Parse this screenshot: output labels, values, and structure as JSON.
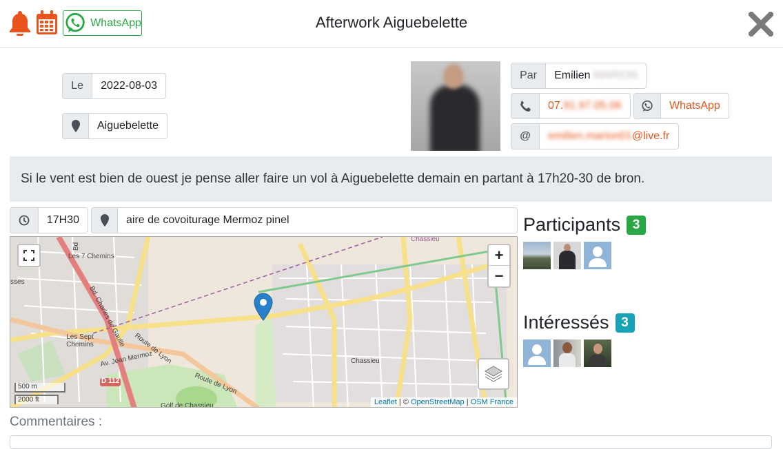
{
  "header": {
    "title": "Afterwork Aiguebelette",
    "whatsapp_label": "WhatsApp",
    "accent": "#e8541b",
    "whatsapp_color": "#28a745"
  },
  "event": {
    "date_label": "Le",
    "date": "2022-08-03",
    "location": "Aiguebelette",
    "description": "Si le vent est bien de ouest je pense aller faire un vol à Aiguebelette demain en partant à 17h20-30 de bron.",
    "time": "17H30",
    "meeting_point": "aire de covoiturage Mermoz pinel"
  },
  "organizer": {
    "by_label": "Par",
    "first_name": "Emilien",
    "last_name_blurred": "MARION",
    "phone_prefix": "07.",
    "phone_blurred": "91.97.05.06",
    "whatsapp_label": "WhatsApp",
    "email_label": "@",
    "email_blurred": "emilien.marion01",
    "email_domain": "@live.fr"
  },
  "map": {
    "labels": {
      "chassieu": "Chassieu",
      "chassieu_top": "Chassieu",
      "les7chemins_top": "Les 7 Chemins",
      "les7chemins": "Les Sept Chemins",
      "bd_charles": "Bd. Charles de Gaulle",
      "av_mermoz": "Av. Jean Mermoz",
      "route_lyon1": "Route de Lyon",
      "route_lyon2": "Route de Lyon",
      "d112": "D 112",
      "golf": "Golf de Chassieu",
      "rue_left": "sses",
      "bd_top": "Bd"
    },
    "scale_m": "500 m",
    "scale_ft": "2000 ft",
    "zoom_in": "+",
    "zoom_out": "−",
    "attribution": {
      "leaflet": "Leaflet",
      "sep1": " | © ",
      "osm": "OpenStreetMap",
      "sep2": " | ",
      "osmfr": "OSM France"
    }
  },
  "participants": {
    "label": "Participants",
    "count": "3",
    "badge_color": "#28a745"
  },
  "interested": {
    "label": "Intéressés",
    "count": "3",
    "badge_color": "#17a2b8"
  },
  "comments": {
    "label": "Commentaires :"
  }
}
